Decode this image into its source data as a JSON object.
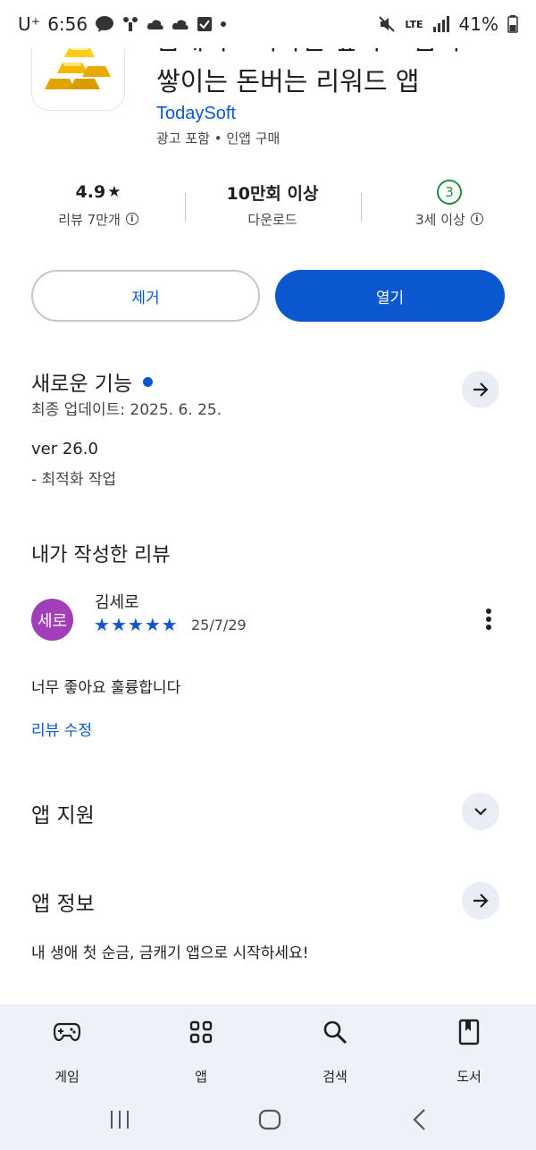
{
  "status_bar": {
    "time": "6:56",
    "carrier": "U⁺",
    "battery": "41%",
    "network": "LTE"
  },
  "app": {
    "title": "금캐기 - 기다린 깊어도 돔이\n쌓이는 돈버는 리워드 앱",
    "developer": "TodaySoft",
    "meta": "광고 포함 • 인앱 구매"
  },
  "stats": {
    "rating": "4.9",
    "rating_star": "★",
    "reviews_label": "리뷰 7만개",
    "downloads": "10만회 이상",
    "downloads_label": "다운로드",
    "age_badge": "3",
    "age_label": "3세 이상"
  },
  "actions": {
    "remove_label": "제거",
    "open_label": "열기"
  },
  "whats_new": {
    "title": "새로운 기능",
    "updated": "최종 업데이트: 2025. 6. 25.",
    "version": "ver 26.0",
    "note": "- 최적화 작업"
  },
  "my_review": {
    "title": "내가 작성한 리뷰",
    "avatar_text": "세로",
    "reviewer": "김세로",
    "stars": 5,
    "date": "25/7/29",
    "text": "너무 좋아요 훌륭합니다",
    "edit_label": "리뷰 수정"
  },
  "app_support": {
    "title": "앱 지원"
  },
  "app_info": {
    "title": "앱 정보",
    "description": "내 생애 첫 순금, 금캐기 앱으로 시작하세요!"
  },
  "bottom_nav": {
    "items": [
      {
        "label": "게임",
        "icon": "gamepad-icon"
      },
      {
        "label": "앱",
        "icon": "apps-grid-icon"
      },
      {
        "label": "검색",
        "icon": "search-icon"
      },
      {
        "label": "도서",
        "icon": "book-icon"
      }
    ]
  },
  "colors": {
    "accent": "#0b57d0",
    "avatar": "#a23fb8",
    "age_badge": "#1e8e3e",
    "nav_background": "#eef2f8"
  }
}
